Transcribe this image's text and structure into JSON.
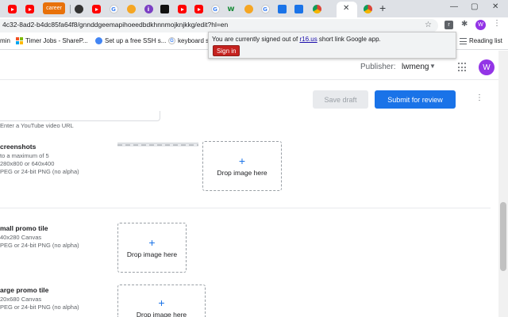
{
  "tabs": {
    "career_label": "career",
    "new_tab_symbol": "+",
    "close_symbol": "✕",
    "items": [
      {
        "icon": "youtube-icon"
      },
      {
        "icon": "youtube-icon"
      },
      {
        "icon": "career-tab"
      },
      {
        "icon": "github-icon"
      },
      {
        "icon": "youtube-icon"
      },
      {
        "icon": "google-icon"
      },
      {
        "icon": "orange-icon"
      },
      {
        "icon": "info-icon"
      },
      {
        "icon": "black-icon"
      },
      {
        "icon": "youtube-icon"
      },
      {
        "icon": "youtube-icon"
      },
      {
        "icon": "google-icon"
      },
      {
        "icon": "wikipedia-icon"
      },
      {
        "icon": "star-icon"
      },
      {
        "icon": "google-icon"
      },
      {
        "icon": "wave-icon"
      },
      {
        "icon": "blue-icon"
      },
      {
        "icon": "chrome-icon"
      },
      {
        "icon": "google-icon"
      },
      {
        "icon": "chrome-icon"
      }
    ],
    "window": {
      "minimize": "—",
      "maximize": "▢",
      "close": "✕"
    }
  },
  "address_bar": {
    "url": "4c32-8ad2-b4dc85fa64f8/gnnddgeemapihoeedbdkhnnmojknjkkg/edit?hl=en",
    "star_symbol": "☆",
    "ext_letter": "r",
    "profile_letter": "W",
    "puzzle_symbol": "✱",
    "kebab_symbol": "⋮"
  },
  "bookmarks": {
    "items": [
      {
        "label": "min",
        "icon": "none"
      },
      {
        "label": "Timer Jobs - ShareP...",
        "icon": "microsoft-icon"
      },
      {
        "label": "Set up a free SSH s...",
        "icon": "cloud-icon"
      },
      {
        "label": "keyboard s",
        "icon": "google-icon"
      }
    ],
    "reading_list": "Reading list"
  },
  "popup": {
    "message_before": "You are currently signed out of ",
    "link": "r16.us",
    "message_after": " short link Google app.",
    "signin_label": "Sign in"
  },
  "header": {
    "publisher_label": "Publisher:",
    "publisher_value": "lwmeng",
    "caret": "▼",
    "avatar_letter": "W"
  },
  "actions": {
    "save_draft": "Save draft",
    "submit": "Submit for review",
    "more": "⋮"
  },
  "video": {
    "hint": "Enter a YouTube video URL"
  },
  "screenshots": {
    "title": "creenshots",
    "lines": [
      "to a maximum of 5",
      "280x800 or 640x400",
      "PEG or 24-bit PNG (no alpha)"
    ],
    "drop_plus": "+",
    "drop_label": "Drop image here"
  },
  "small_promo": {
    "title": "mall promo tile",
    "lines": [
      "40x280 Canvas",
      "PEG or 24-bit PNG (no alpha)"
    ],
    "drop_plus": "+",
    "drop_label": "Drop image here"
  },
  "large_promo": {
    "title": "arge promo tile",
    "lines": [
      "20x680 Canvas",
      "PEG or 24-bit PNG (no alpha)"
    ],
    "drop_plus": "+",
    "drop_label": "Drop image here"
  }
}
